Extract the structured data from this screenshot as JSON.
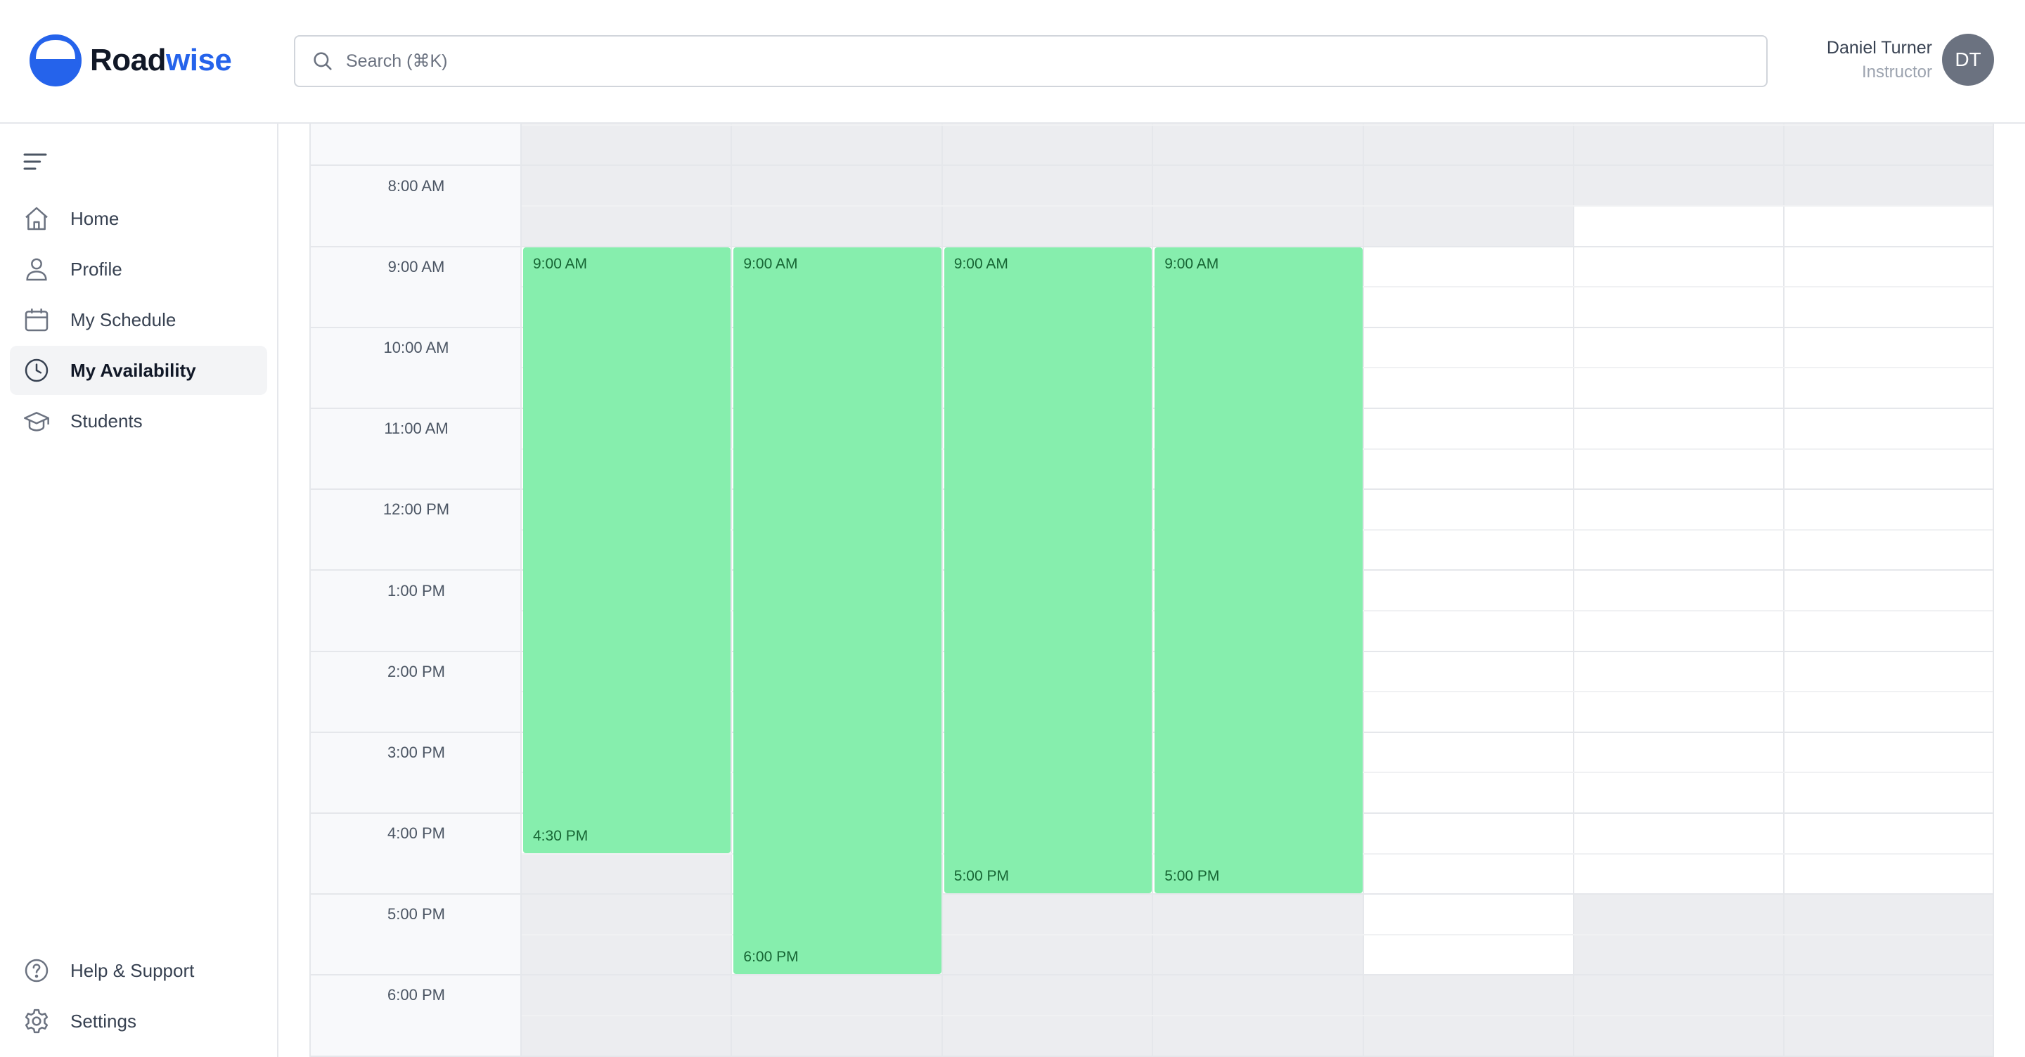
{
  "brand": {
    "name_part1": "Road",
    "name_part2": "wise",
    "accent": "#2563eb"
  },
  "search": {
    "placeholder": "Search (⌘K)"
  },
  "user": {
    "name": "Daniel Turner",
    "role": "Instructor",
    "initials": "DT"
  },
  "sidebar": {
    "items": [
      {
        "label": "Home",
        "icon": "home-icon"
      },
      {
        "label": "Profile",
        "icon": "user-icon"
      },
      {
        "label": "My Schedule",
        "icon": "calendar-icon"
      },
      {
        "label": "My Availability",
        "icon": "clock-icon",
        "active": true
      },
      {
        "label": "Students",
        "icon": "graduation-cap-icon"
      }
    ],
    "bottom_items": [
      {
        "label": "Help & Support",
        "icon": "help-icon"
      },
      {
        "label": "Settings",
        "icon": "gear-icon"
      }
    ]
  },
  "calendar": {
    "time_labels": [
      "8:00 AM",
      "9:00 AM",
      "10:00 AM",
      "11:00 AM",
      "12:00 PM",
      "1:00 PM",
      "2:00 PM",
      "3:00 PM",
      "4:00 PM",
      "5:00 PM",
      "6:00 PM"
    ],
    "slots": [
      {
        "start_label": "9:00 AM",
        "end_label": "4:30 PM"
      },
      {
        "start_label": "9:00 AM",
        "end_label": "6:00 PM"
      },
      {
        "start_label": "9:00 AM",
        "end_label": "5:00 PM"
      },
      {
        "start_label": "9:00 AM",
        "end_label": "5:00 PM"
      }
    ],
    "colors": {
      "available": "#86eead",
      "unavailable": "#ecedf0",
      "available_text": "#166534"
    }
  }
}
